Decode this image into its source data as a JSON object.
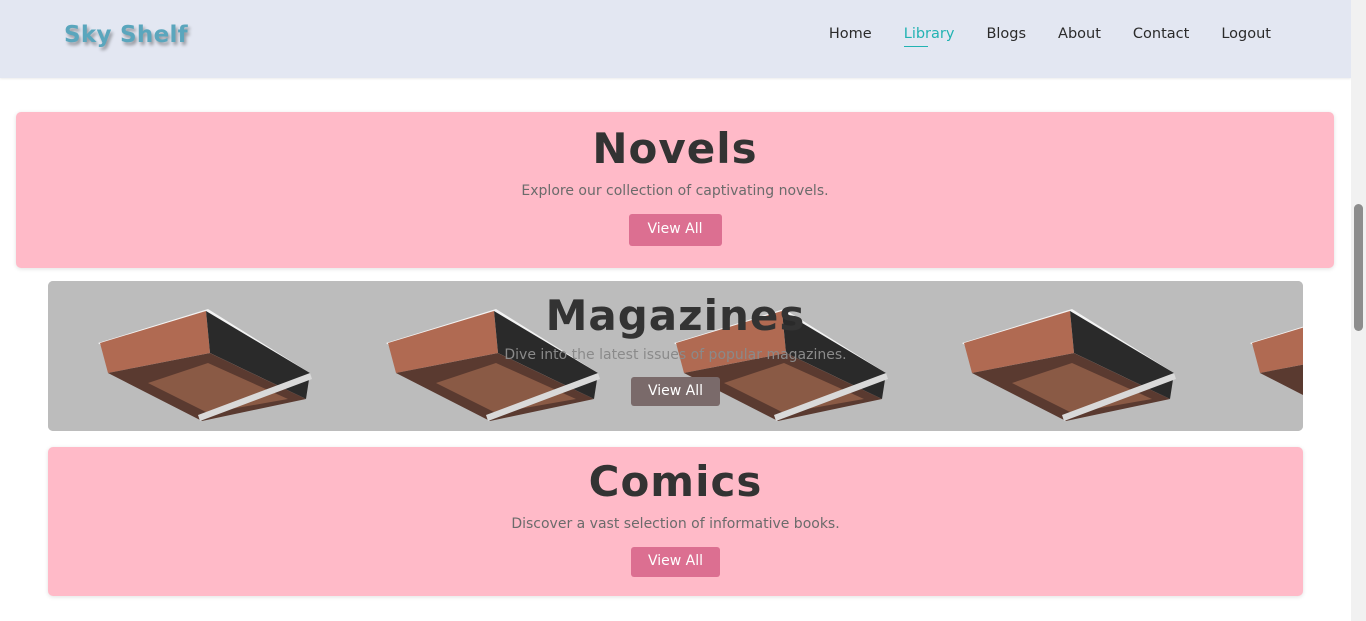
{
  "header": {
    "logo": "Sky Shelf",
    "nav": [
      {
        "label": "Home",
        "active": false
      },
      {
        "label": "Library",
        "active": true
      },
      {
        "label": "Blogs",
        "active": false
      },
      {
        "label": "About",
        "active": false
      },
      {
        "label": "Contact",
        "active": false
      },
      {
        "label": "Logout",
        "active": false
      }
    ]
  },
  "colors": {
    "header_bg": "#e3e7f2",
    "logo": "#5aa6bd",
    "nav_active": "#22b3b3",
    "card_pink": "#ffbac8",
    "button_pink": "#dc6f91",
    "button_grey": "#7a6a6a"
  },
  "categories": [
    {
      "title": "Novels",
      "description": "Explore our collection of captivating novels.",
      "button": "View All"
    },
    {
      "title": "Magazines",
      "description": "Dive into the latest issues of popular magazines.",
      "button": "View All"
    },
    {
      "title": "Comics",
      "description": "Discover a vast selection of informative books.",
      "button": "View All"
    }
  ]
}
